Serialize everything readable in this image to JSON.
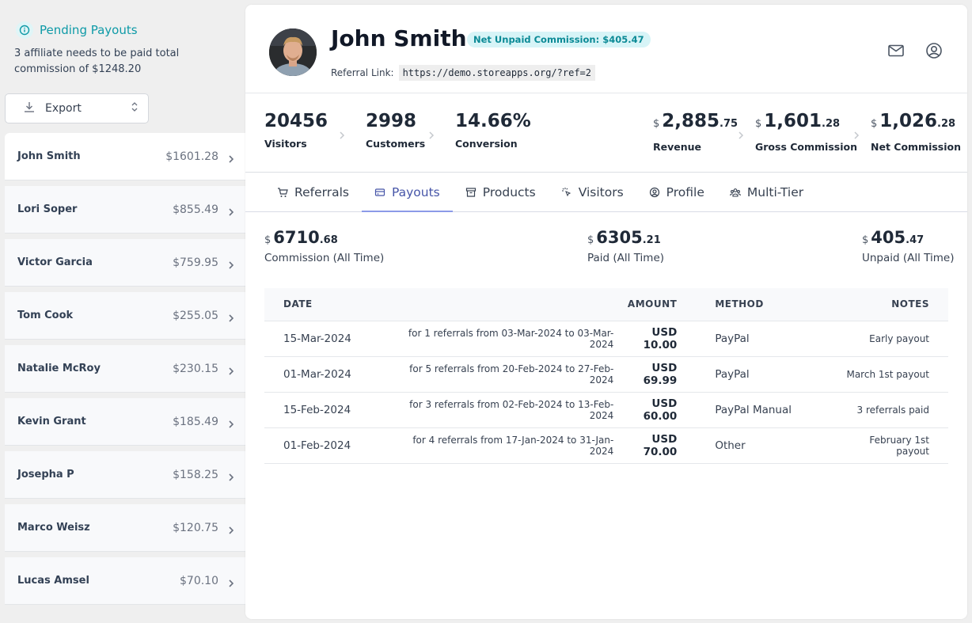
{
  "sidebar": {
    "pending_title": "Pending Payouts",
    "pending_desc": "3 affiliate needs to be paid total commission of $1248.20",
    "export_label": "Export",
    "affiliates": [
      {
        "name": "John Smith",
        "amount": "$1601.28",
        "active": true
      },
      {
        "name": "Lori Soper",
        "amount": "$855.49"
      },
      {
        "name": "Victor Garcia",
        "amount": "$759.95"
      },
      {
        "name": "Tom Cook",
        "amount": "$255.05"
      },
      {
        "name": "Natalie McRoy",
        "amount": "$230.15"
      },
      {
        "name": "Kevin Grant",
        "amount": "$185.49"
      },
      {
        "name": "Josepha P",
        "amount": "$158.25"
      },
      {
        "name": "Marco Weisz",
        "amount": "$120.75"
      },
      {
        "name": "Lucas Amsel",
        "amount": "$70.10"
      }
    ]
  },
  "profile": {
    "name": "John Smith",
    "badge": "Net Unpaid Commission: $405.47",
    "referral_label": "Referral Link:",
    "referral_link": "https://demo.storeapps.org/?ref=2",
    "icons": [
      "mail-icon",
      "user-circle-icon"
    ]
  },
  "stats": {
    "visitors": {
      "value": "20456",
      "label": "Visitors"
    },
    "customers": {
      "value": "2998",
      "label": "Customers"
    },
    "conversion": {
      "value": "14.66%",
      "label": "Conversion"
    },
    "revenue": {
      "currency": "$",
      "whole": "2,885",
      "cents": ".75",
      "label": "Revenue"
    },
    "gross": {
      "currency": "$",
      "whole": "1,601",
      "cents": ".28",
      "label": "Gross Commission"
    },
    "net": {
      "currency": "$",
      "whole": "1,026",
      "cents": ".28",
      "label": "Net Commission"
    }
  },
  "tabs": [
    {
      "label": "Referrals",
      "icon": "cart-icon"
    },
    {
      "label": "Payouts",
      "icon": "credit-card-icon",
      "active": true
    },
    {
      "label": "Products",
      "icon": "archive-box-icon"
    },
    {
      "label": "Visitors",
      "icon": "cursor-click-icon"
    },
    {
      "label": "Profile",
      "icon": "user-circle-icon"
    },
    {
      "label": "Multi-Tier",
      "icon": "user-group-icon"
    }
  ],
  "payout_summary": {
    "commission": {
      "currency": "$",
      "whole": "6710",
      "cents": ".68",
      "label": "Commission (All Time)"
    },
    "paid": {
      "currency": "$",
      "whole": "6305",
      "cents": ".21",
      "label": "Paid (All Time)"
    },
    "unpaid": {
      "currency": "$",
      "whole": "405",
      "cents": ".47",
      "label": "Unpaid (All Time)"
    }
  },
  "payouts_table": {
    "headers": {
      "date": "DATE",
      "amount": "AMOUNT",
      "method": "METHOD",
      "notes": "NOTES"
    },
    "rows": [
      {
        "date": "15-Mar-2024",
        "desc": "for 1 referrals from 03-Mar-2024 to 03-Mar-2024",
        "amount": "USD 10.00",
        "method": "PayPal",
        "notes": "Early payout"
      },
      {
        "date": "01-Mar-2024",
        "desc": "for 5 referrals from 20-Feb-2024 to 27-Feb-2024",
        "amount": "USD 69.99",
        "method": "PayPal",
        "notes": "March 1st payout"
      },
      {
        "date": "15-Feb-2024",
        "desc": "for 3 referrals from 02-Feb-2024 to 13-Feb-2024",
        "amount": "USD 60.00",
        "method": "PayPal Manual",
        "notes": "3 referrals paid"
      },
      {
        "date": "01-Feb-2024",
        "desc": "for 4 referrals from 17-Jan-2024 to 31-Jan-2024",
        "amount": "USD 70.00",
        "method": "Other",
        "notes": "February 1st payout"
      }
    ]
  },
  "colors": {
    "accent": "#0e9aa7",
    "tab_active": "#4655a8",
    "tab_underline": "#8c9ae8",
    "badge_bg": "#d7f4f7"
  }
}
